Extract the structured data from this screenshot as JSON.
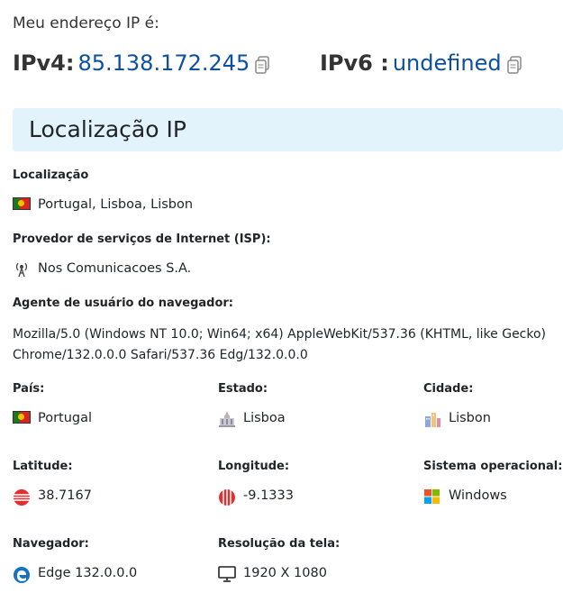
{
  "header": {
    "subtitle": "Meu endereço IP é:",
    "ipv4_label": "IPv4:",
    "ipv4_value": "85.138.172.245",
    "ipv6_label": "IPv6 :",
    "ipv6_value": "undefined"
  },
  "section": {
    "title": "Localização IP"
  },
  "location": {
    "label": "Localização",
    "value": "Portugal, Lisboa, Lisbon",
    "icon": "portugal-flag-icon"
  },
  "isp": {
    "label": "Provedor de serviços de Internet (ISP):",
    "value": "Nos Comunicacoes S.A.",
    "icon": "antenna-icon"
  },
  "user_agent": {
    "label": "Agente de usuário do navegador:",
    "value": "Mozilla/5.0 (Windows NT 10.0; Win64; x64) AppleWebKit/537.36 (KHTML, like Gecko) Chrome/132.0.0.0 Safari/537.36 Edg/132.0.0.0"
  },
  "grid": {
    "country": {
      "label": "País:",
      "value": "Portugal"
    },
    "state": {
      "label": "Estado:",
      "value": "Lisboa"
    },
    "city": {
      "label": "Cidade:",
      "value": "Lisbon"
    },
    "latitude": {
      "label": "Latitude:",
      "value": "38.7167"
    },
    "longitude": {
      "label": "Longitude:",
      "value": "-9.1333"
    },
    "os": {
      "label": "Sistema operacional:",
      "value": "Windows"
    },
    "browser": {
      "label": "Navegador:",
      "value": "Edge 132.0.0.0"
    },
    "resolution": {
      "label": "Resolução da tela:",
      "value": "1920 X 1080"
    }
  },
  "colors": {
    "ip_value": "#0d4fa1",
    "section_bg": "#e3f3fc"
  }
}
